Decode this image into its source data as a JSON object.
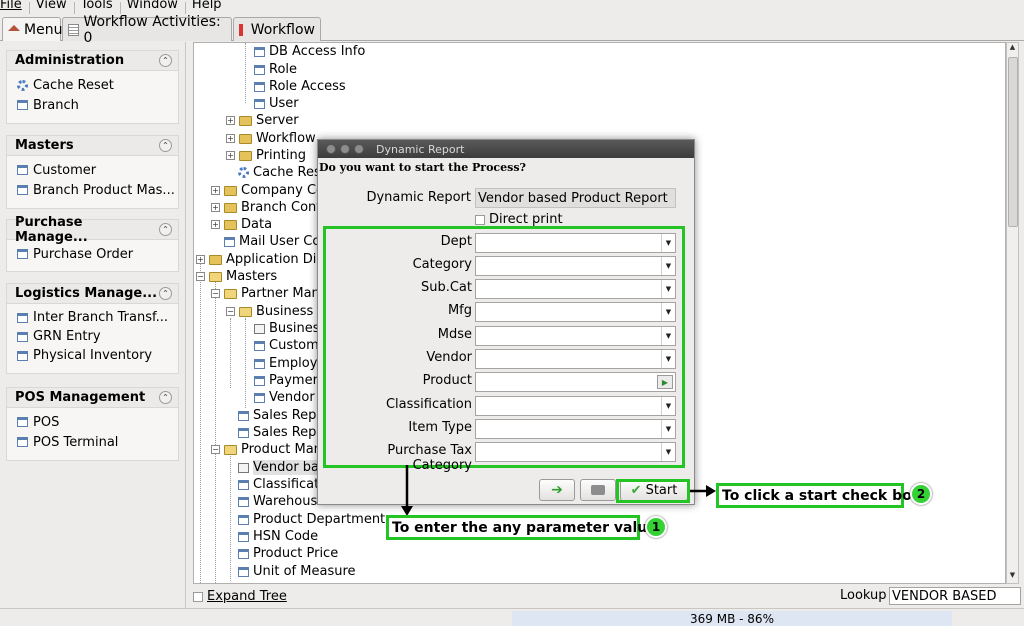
{
  "menu": [
    "File",
    "View",
    "Tools",
    "Window",
    "Help"
  ],
  "tabs": [
    {
      "label": "Menu",
      "icon": "home-icon"
    },
    {
      "label": "Workflow Activities: 0",
      "icon": "list-icon"
    },
    {
      "label": "Workflow",
      "icon": "workflow-icon"
    }
  ],
  "left_groups": [
    {
      "title": "Administration",
      "items": [
        {
          "label": "Cache Reset",
          "icon": "gear-icon"
        },
        {
          "label": "Branch",
          "icon": "doc-icon"
        }
      ]
    },
    {
      "title": "Masters",
      "items": [
        {
          "label": "Customer",
          "icon": "doc-icon"
        },
        {
          "label": "Branch Product Mas...",
          "icon": "doc-icon"
        }
      ]
    },
    {
      "title": "Purchase Manage...",
      "items": [
        {
          "label": "Purchase Order",
          "icon": "doc-icon"
        }
      ]
    },
    {
      "title": "Logistics Manage...",
      "items": [
        {
          "label": "Inter Branch Transf...",
          "icon": "doc-icon"
        },
        {
          "label": "GRN Entry",
          "icon": "doc-icon"
        },
        {
          "label": "Physical Inventory",
          "icon": "doc-icon"
        }
      ]
    },
    {
      "title": "POS Management",
      "items": [
        {
          "label": "POS",
          "icon": "doc-icon"
        },
        {
          "label": "POS Terminal",
          "icon": "doc-icon"
        }
      ]
    }
  ],
  "tree": [
    {
      "label": "DB Access Info"
    },
    {
      "label": "Role"
    },
    {
      "label": "Role Access"
    },
    {
      "label": "User"
    },
    {
      "label": "Server"
    },
    {
      "label": "Workflow"
    },
    {
      "label": "Printing"
    },
    {
      "label": "Cache Res"
    },
    {
      "label": "Company Co"
    },
    {
      "label": "Branch Conf"
    },
    {
      "label": "Data"
    },
    {
      "label": "Mail User Co"
    },
    {
      "label": "Application Dic"
    },
    {
      "label": "Masters"
    },
    {
      "label": "Partner Mana"
    },
    {
      "label": "Business F"
    },
    {
      "label": "Busines"
    },
    {
      "label": "Custom"
    },
    {
      "label": "Employ"
    },
    {
      "label": "Paymer"
    },
    {
      "label": "Vendor"
    },
    {
      "label": "Sales Rep"
    },
    {
      "label": "Sales Rep"
    },
    {
      "label": "Product Man"
    },
    {
      "label": "Vendor ba"
    },
    {
      "label": "Classificat"
    },
    {
      "label": "Warehouse"
    },
    {
      "label": "Product Department"
    },
    {
      "label": "HSN Code"
    },
    {
      "label": "Product Price"
    },
    {
      "label": "Unit of Measure"
    }
  ],
  "bottom": {
    "expand_label": "Expand Tree",
    "lookup_label": "Lookup",
    "lookup_value": "VENDOR BASED"
  },
  "status": {
    "memory": "369 MB - 86%"
  },
  "dialog": {
    "title": "Dynamic Report",
    "prompt": "Do you want to start the Process?",
    "report_label": "Dynamic Report",
    "report_value": "Vendor based Product Report",
    "direct_print": "Direct print",
    "params": [
      "Dept",
      "Category",
      "Sub.Cat",
      "Mfg",
      "Mdse",
      "Vendor",
      "Product",
      "Classification",
      "Item Type",
      "Purchase Tax Category"
    ],
    "start_label": "Start"
  },
  "callouts": {
    "one_text": "To enter the any parameter values",
    "one_num": "1",
    "two_text": "To click a start check box",
    "two_num": "2"
  },
  "colors": {
    "highlight": "#23c423",
    "badge": "#35d235"
  }
}
